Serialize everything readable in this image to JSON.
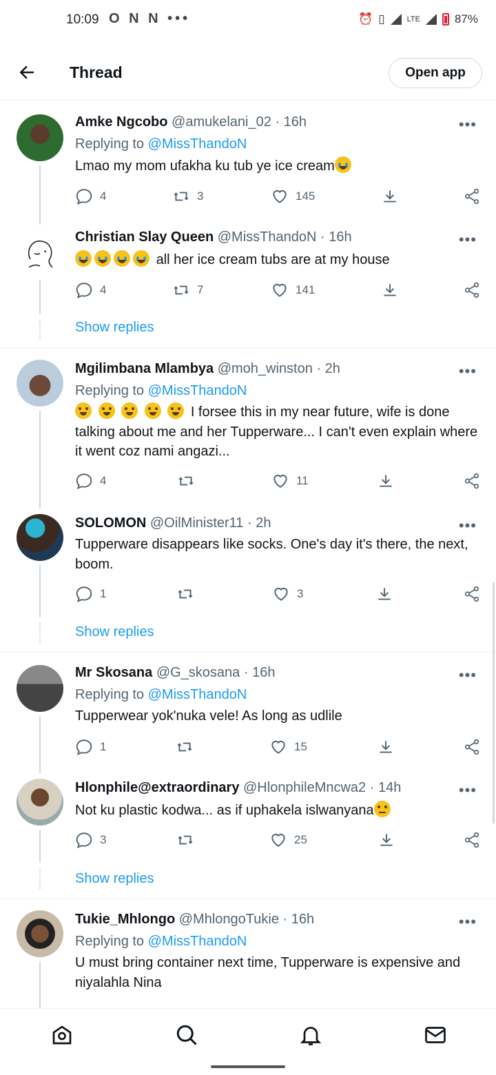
{
  "status_bar": {
    "time": "10:09",
    "left_icons": "O N N •••",
    "network": "LTE",
    "battery": "87%"
  },
  "header": {
    "title": "Thread",
    "open_app_label": "Open app"
  },
  "colors": {
    "link": "#1d9bf0",
    "muted": "#536471",
    "text": "#0f1419"
  },
  "tweets": [
    {
      "name": "Amke Ngcobo",
      "handle": "@amukelani_02",
      "sep": "·",
      "time": "16h",
      "replying_prefix": "Replying to ",
      "replying_to": "@MissThandoN",
      "text": "Lmao my mom ufakha ku tub ye ice cream",
      "replies": "4",
      "retweets": "3",
      "likes": "145"
    },
    {
      "name": "Christian Slay Queen",
      "handle": "@MissThandoN",
      "sep": "·",
      "time": "16h",
      "text": "all her ice cream tubs are at my house",
      "replies": "4",
      "retweets": "7",
      "likes": "141"
    },
    {
      "name": "Mgilimbana Mlambya",
      "handle": "@moh_winston",
      "sep": "·",
      "time": "2h",
      "replying_prefix": "Replying to ",
      "replying_to": "@MissThandoN",
      "text": "I forsee this in my near future, wife is done talking about me and her Tupperware... I can't even explain where it went coz nami angazi...",
      "replies": "4",
      "retweets": "",
      "likes": "11"
    },
    {
      "name": "SOLOMON",
      "handle": "@OilMinister11",
      "sep": "·",
      "time": "2h",
      "text": "Tupperware disappears like socks. One's day it's there, the next, boom.",
      "replies": "1",
      "retweets": "",
      "likes": "3"
    },
    {
      "name": "Mr Skosana",
      "handle": "@G_skosana",
      "sep": "·",
      "time": "16h",
      "replying_prefix": "Replying to ",
      "replying_to": "@MissThandoN",
      "text": "Tupperwear yok'nuka vele! As long as udlile",
      "replies": "1",
      "retweets": "",
      "likes": "15"
    },
    {
      "name": "Hlonphile@extraordinary",
      "handle": "@HlonphileMncwa2",
      "sep": "·",
      "time": "14h",
      "text": "Not ku plastic kodwa... as if uphakela islwanyana",
      "replies": "3",
      "retweets": "",
      "likes": "25"
    },
    {
      "name": "Tukie_Mhlongo",
      "handle": "@MhlongoTukie",
      "sep": "·",
      "time": "16h",
      "replying_prefix": "Replying to ",
      "replying_to": "@MissThandoN",
      "text": "U must bring container next time, Tupperware is expensive and niyalahla Nina"
    }
  ],
  "show_replies_label": "Show replies",
  "more_label": "•••",
  "bottom_nav": [
    "home",
    "search",
    "notifications",
    "messages"
  ]
}
